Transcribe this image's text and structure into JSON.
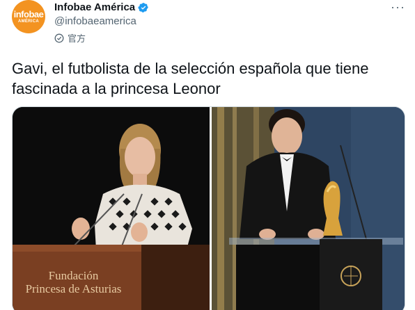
{
  "account": {
    "display_name": "Infobae América",
    "handle": "@infobaeamerica",
    "official_label": "官方",
    "avatar_brand": "infobae",
    "avatar_sub": "AMÉRICA",
    "verified": true
  },
  "menu": {
    "more_label": "···"
  },
  "tweet": {
    "text": "Gavi, el futbolista de la selección española que tiene fascinada a la princesa Leonor"
  },
  "media": {
    "left_photo": {
      "description_icon": "photo-princess-speaking",
      "podium_line1": "Fundación",
      "podium_line2": "Princesa de Asturias"
    },
    "right_photo": {
      "description_icon": "photo-player-trophy"
    }
  },
  "colors": {
    "brand_orange": "#f39321",
    "verified_blue": "#1d9bf0",
    "secondary_text": "#536471",
    "primary_text": "#0f1419"
  }
}
